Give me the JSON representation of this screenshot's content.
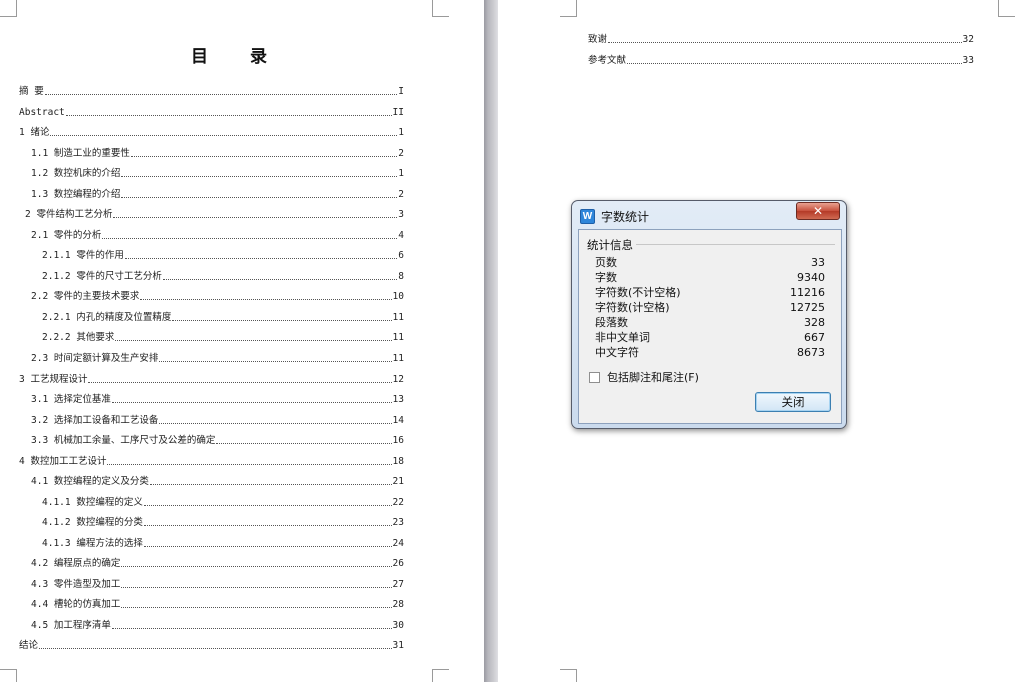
{
  "toc": {
    "title": "目   录",
    "entries": [
      {
        "label": "摘  要",
        "page": "I"
      },
      {
        "label": "Abstract",
        "page": "II"
      },
      {
        "label": "1 绪论",
        "page": "1"
      },
      {
        "label": "1.1 制造工业的重要性",
        "page": "2"
      },
      {
        "label": "1.2 数控机床的介绍",
        "page": "1"
      },
      {
        "label": "1.3 数控编程的介绍",
        "page": "2"
      },
      {
        "label": "2 零件结构工艺分析",
        "page": "3"
      },
      {
        "label": "2.1 零件的分析",
        "page": "4"
      },
      {
        "label": "2.1.1 零件的作用",
        "page": "6"
      },
      {
        "label": "2.1.2 零件的尺寸工艺分析",
        "page": "8"
      },
      {
        "label": "2.2 零件的主要技术要求",
        "page": "10"
      },
      {
        "label": "2.2.1 内孔的精度及位置精度",
        "page": "11"
      },
      {
        "label": "2.2.2 其他要求",
        "page": "11"
      },
      {
        "label": "2.3 时间定额计算及生产安排",
        "page": "11"
      },
      {
        "label": "3 工艺规程设计",
        "page": "12"
      },
      {
        "label": "3.1 选择定位基准",
        "page": "13"
      },
      {
        "label": "3.2 选择加工设备和工艺设备",
        "page": "14"
      },
      {
        "label": "3.3 机械加工余量、工序尺寸及公差的确定",
        "page": "16"
      },
      {
        "label": "4 数控加工工艺设计",
        "page": "18"
      },
      {
        "label": "4.1 数控编程的定义及分类",
        "page": "21"
      },
      {
        "label": "4.1.1 数控编程的定义",
        "page": "22"
      },
      {
        "label": "4.1.2 数控编程的分类",
        "page": "23"
      },
      {
        "label": "4.1.3 编程方法的选择",
        "page": "24"
      },
      {
        "label": "4.2 编程原点的确定",
        "page": "26"
      },
      {
        "label": "4.3 零件造型及加工",
        "page": "27"
      },
      {
        "label": "4.4 槽轮的仿真加工",
        "page": "28"
      },
      {
        "label": "4.5 加工程序清单",
        "page": "30"
      },
      {
        "label": "结论",
        "page": "31"
      }
    ],
    "continued": [
      {
        "label": "致谢",
        "page": "32"
      },
      {
        "label": "参考文献",
        "page": "33"
      }
    ]
  },
  "dialog": {
    "title": "字数统计",
    "app_icon": "W",
    "close_glyph": "✕",
    "group_label": "统计信息",
    "stats": [
      {
        "label": "页数",
        "value": "33"
      },
      {
        "label": "字数",
        "value": "9340"
      },
      {
        "label": "字符数(不计空格)",
        "value": "11216"
      },
      {
        "label": "字符数(计空格)",
        "value": "12725"
      },
      {
        "label": "段落数",
        "value": "328"
      },
      {
        "label": "非中文单词",
        "value": "667"
      },
      {
        "label": "中文字符",
        "value": "8673"
      }
    ],
    "checkbox_label": "包括脚注和尾注(F)",
    "checkbox_checked": false,
    "close_button": "关闭"
  },
  "colors": {
    "gutter": "#b7b7bd",
    "dialog_frame": "#cbdbee",
    "close_red": "#c7503c",
    "button_border": "#3c7fb1"
  }
}
